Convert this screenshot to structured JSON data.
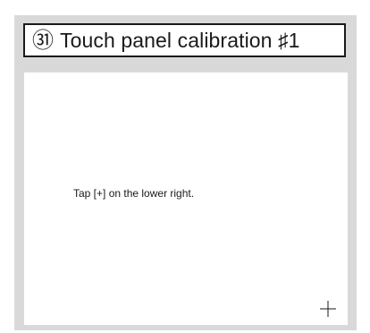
{
  "title": {
    "step_number": "㉛",
    "text": "Touch panel calibration ♯1"
  },
  "canvas": {
    "instruction": "Tap [+] on the lower right."
  },
  "target": {
    "icon": "crosshair-plus-icon"
  },
  "colors": {
    "frame": "#d9d9d9",
    "panel": "#ffffff",
    "text": "#1a1a1a"
  }
}
